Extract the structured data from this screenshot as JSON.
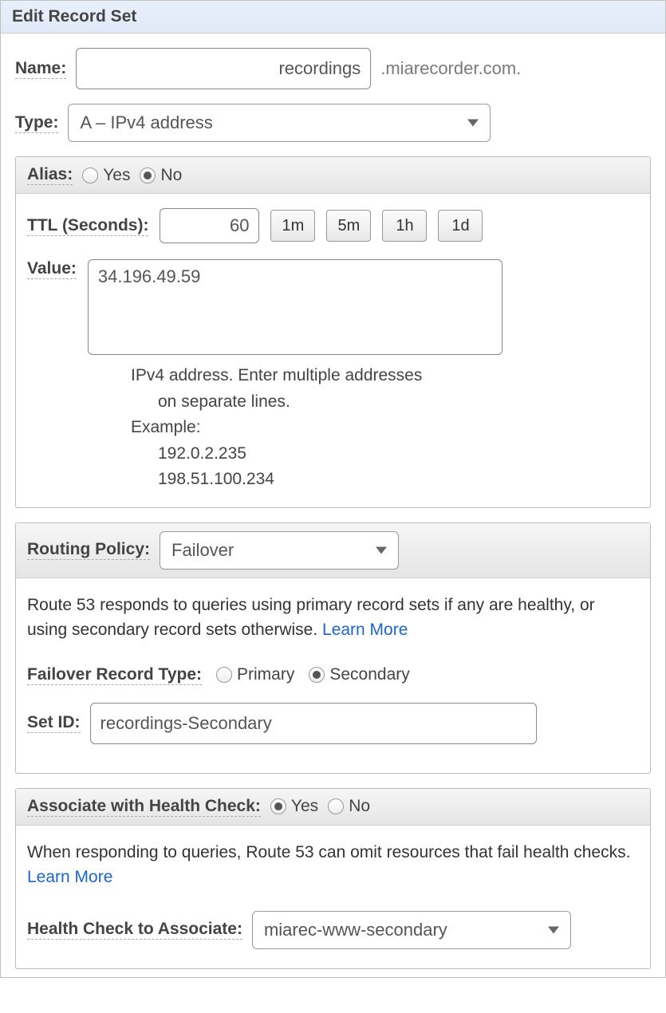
{
  "header": {
    "title": "Edit Record Set"
  },
  "name": {
    "label": "Name:",
    "value": "recordings",
    "suffix": ".miarecorder.com."
  },
  "type": {
    "label": "Type:",
    "selected": "A – IPv4 address"
  },
  "alias": {
    "label": "Alias:",
    "yes": "Yes",
    "no": "No",
    "selected": "No"
  },
  "ttl": {
    "label": "TTL (Seconds):",
    "value": "60",
    "presets": [
      "1m",
      "5m",
      "1h",
      "1d"
    ]
  },
  "value": {
    "label": "Value:",
    "text": "34.196.49.59",
    "help_line1": "IPv4 address. Enter multiple addresses",
    "help_line2": "on separate lines.",
    "help_example_label": "Example:",
    "help_example1": "192.0.2.235",
    "help_example2": "198.51.100.234"
  },
  "routing": {
    "label": "Routing Policy:",
    "selected": "Failover",
    "description": "Route 53 responds to queries using primary record sets if any are healthy, or using secondary record sets otherwise.  ",
    "learn_more": "Learn More"
  },
  "failover": {
    "label": "Failover Record Type:",
    "primary": "Primary",
    "secondary": "Secondary",
    "selected": "Secondary"
  },
  "setid": {
    "label": "Set ID:",
    "value": "recordings-Secondary"
  },
  "healthcheck": {
    "label": "Associate with Health Check:",
    "yes": "Yes",
    "no": "No",
    "selected": "Yes",
    "description": "When responding to queries, Route 53 can omit resources that fail health checks.  ",
    "learn_more": "Learn More",
    "associate_label": "Health Check to Associate:",
    "associate_selected": "miarec-www-secondary"
  }
}
